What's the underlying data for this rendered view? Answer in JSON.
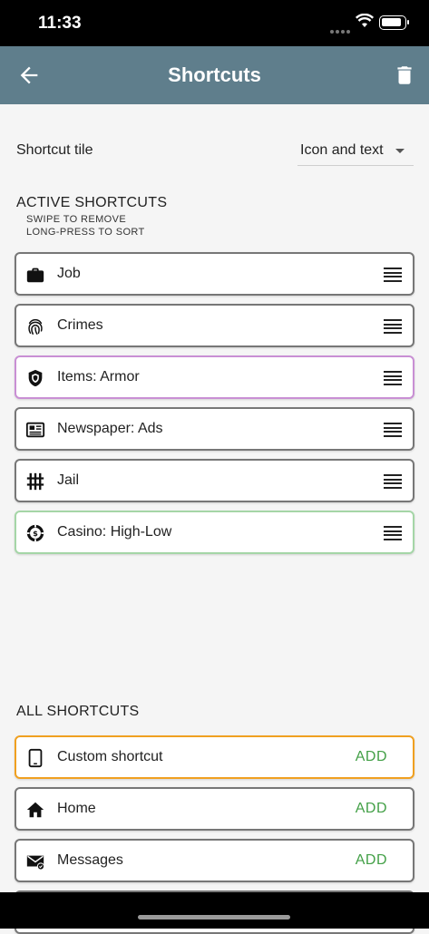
{
  "status": {
    "time": "11:33"
  },
  "header": {
    "title": "Shortcuts"
  },
  "tile": {
    "label": "Shortcut tile",
    "value": "Icon and text"
  },
  "active": {
    "title": "ACTIVE SHORTCUTS",
    "hint1": "SWIPE TO REMOVE",
    "hint2": "LONG-PRESS TO SORT",
    "items": [
      {
        "label": "Job",
        "icon": "briefcase-icon",
        "border": "#777777"
      },
      {
        "label": "Crimes",
        "icon": "fingerprint-icon",
        "border": "#777777"
      },
      {
        "label": "Items: Armor",
        "icon": "shield-icon",
        "border": "#c98fd4"
      },
      {
        "label": "Newspaper: Ads",
        "icon": "newspaper-icon",
        "border": "#777777"
      },
      {
        "label": "Jail",
        "icon": "bars-icon",
        "border": "#777777"
      },
      {
        "label": "Casino: High-Low",
        "icon": "casino-chip-icon",
        "border": "#a5d6a7"
      }
    ]
  },
  "all": {
    "title": "ALL SHORTCUTS",
    "add_label": "ADD",
    "items": [
      {
        "label": "Custom shortcut",
        "icon": "tablet-icon",
        "border": "#f0a020"
      },
      {
        "label": "Home",
        "icon": "home-icon",
        "border": "#777777"
      },
      {
        "label": "Messages",
        "icon": "mail-icon",
        "border": "#777777"
      }
    ]
  },
  "colors": {
    "appbar": "#5f7e8c",
    "add": "#43a047"
  }
}
